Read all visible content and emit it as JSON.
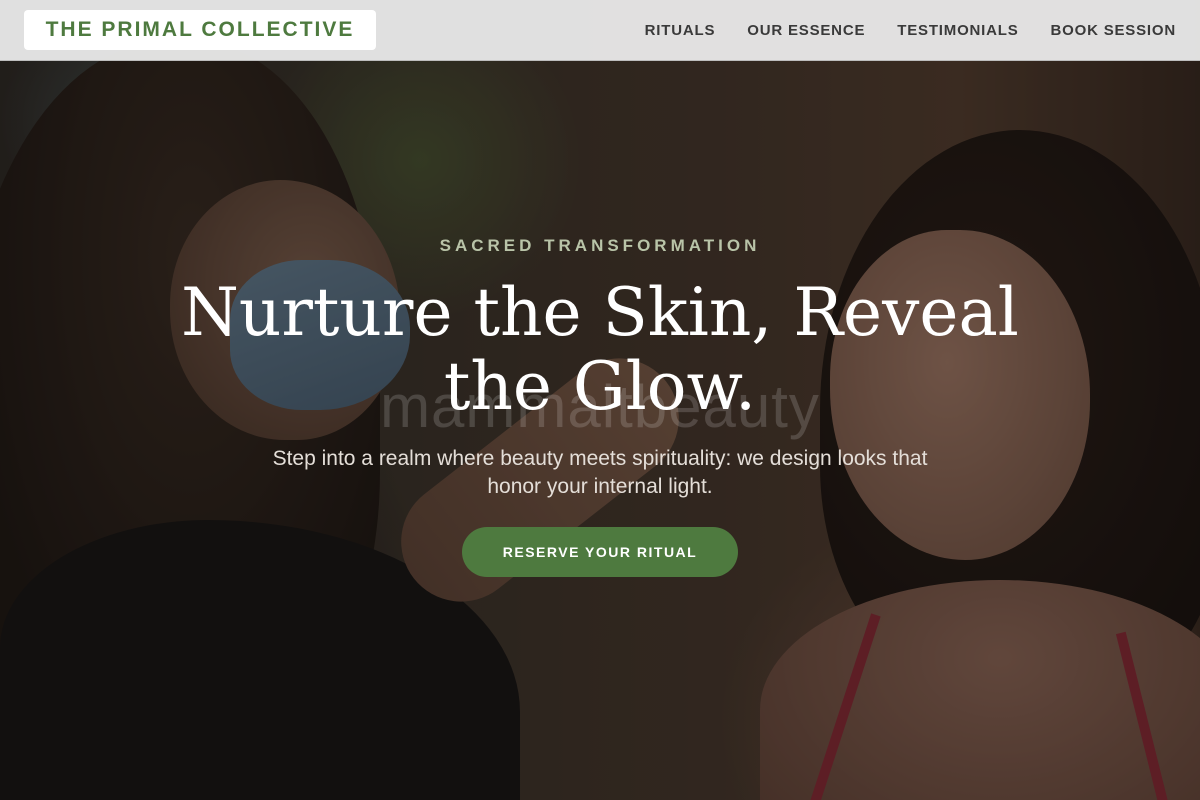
{
  "header": {
    "brand": "THE PRIMAL COLLECTIVE",
    "nav": [
      {
        "label": "RITUALS"
      },
      {
        "label": "OUR ESSENCE"
      },
      {
        "label": "TESTIMONIALS"
      },
      {
        "label": "BOOK SESSION"
      }
    ]
  },
  "hero": {
    "eyebrow": "SACRED TRANSFORMATION",
    "headline": "Nurture the Skin, Reveal the Glow.",
    "subtext": "Step into a realm where beauty meets spirituality: we design looks that honor your internal light.",
    "cta_label": "RESERVE YOUR RITUAL",
    "watermark": "mammaltbeauty"
  },
  "colors": {
    "accent_green": "#4e7a3f",
    "eyebrow_text": "#b9c4a8",
    "nav_background": "#e8e8e8"
  }
}
